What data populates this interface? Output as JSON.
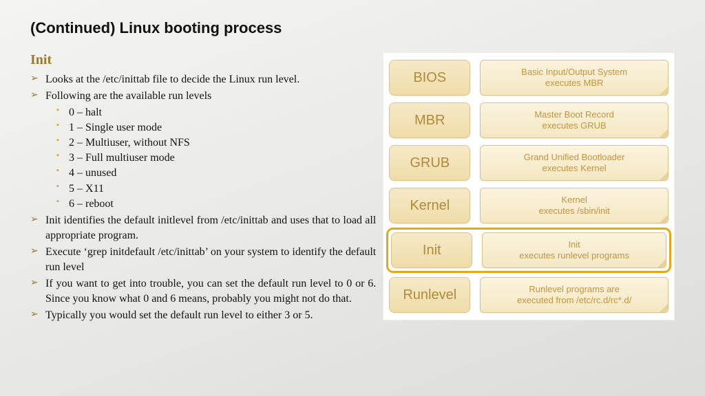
{
  "title": "(Continued) Linux booting process",
  "section": "Init",
  "bullets": {
    "b0": "Looks at the /etc/inittab file to decide the Linux run level.",
    "b1": "Following are the available run levels",
    "sub": {
      "s0": "0 – halt",
      "s1": "1 – Single user mode",
      "s2": "2 – Multiuser, without NFS",
      "s3": "3 – Full multiuser mode",
      "s4": "4 – unused",
      "s5": "5 – X11",
      "s6": "6 – reboot"
    },
    "b2": "Init identifies the default initlevel from /etc/inittab and uses that to load all appropriate program.",
    "b3": "Execute ‘grep initdefault /etc/inittab’ on your system to identify the default run level",
    "b4": "If you want to get into trouble, you can set the default run level to 0 or 6. Since you know what 0 and 6 means, probably you might not do that.",
    "b5": "Typically you would set the default run level to either 3 or 5."
  },
  "diagram": {
    "rows": [
      {
        "name": "BIOS",
        "desc": "Basic Input/Output System\nexecutes MBR"
      },
      {
        "name": "MBR",
        "desc": "Master Boot Record\nexecutes GRUB"
      },
      {
        "name": "GRUB",
        "desc": "Grand Unified Bootloader\nexecutes Kernel"
      },
      {
        "name": "Kernel",
        "desc": "Kernel\nexecutes /sbin/init"
      },
      {
        "name": "Init",
        "desc": "Init\nexecutes runlevel programs",
        "highlight": true
      },
      {
        "name": "Runlevel",
        "desc": "Runlevel programs are\nexecuted from /etc/rc.d/rc*.d/"
      }
    ]
  }
}
